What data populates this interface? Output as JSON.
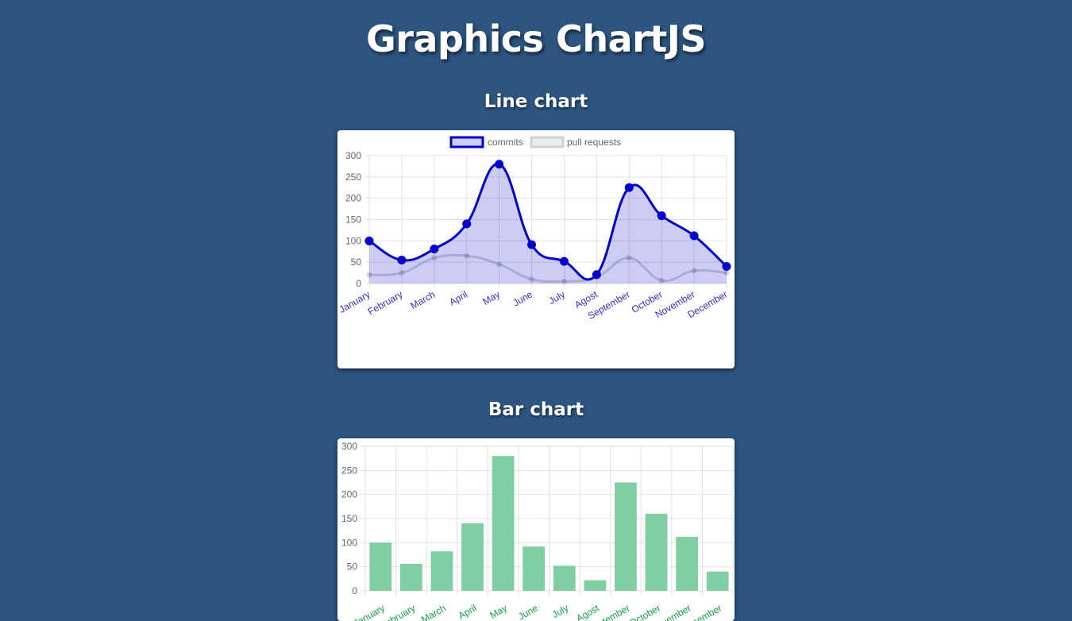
{
  "page": {
    "title": "Graphics ChartJS"
  },
  "sections": [
    {
      "title": "Line chart"
    },
    {
      "title": "Bar chart"
    }
  ],
  "chart_data": [
    {
      "type": "line",
      "categories": [
        "January",
        "February",
        "March",
        "April",
        "May",
        "June",
        "July",
        "Agost",
        "September",
        "October",
        "November",
        "December"
      ],
      "series": [
        {
          "name": "commits",
          "values": [
            100,
            55,
            81,
            140,
            280,
            91,
            52,
            21,
            225,
            159,
            112,
            40
          ],
          "color": "#0000cc",
          "fill": "rgba(0,0,204,0.2)"
        },
        {
          "name": "pull requests",
          "values": [
            20,
            25,
            60,
            65,
            45,
            10,
            5,
            15,
            60,
            7,
            30,
            25
          ],
          "color": "rgba(120,120,140,0.3)"
        }
      ],
      "ylim": [
        0,
        300
      ],
      "yticks": [
        0,
        50,
        100,
        150,
        200,
        250,
        300
      ],
      "grid": true,
      "legend": "top-center",
      "tick_color": "#3333cc"
    },
    {
      "type": "bar",
      "categories": [
        "January",
        "February",
        "March",
        "April",
        "May",
        "June",
        "July",
        "Agost",
        "September",
        "October",
        "November",
        "December"
      ],
      "values": [
        100,
        56,
        82,
        140,
        280,
        92,
        52,
        22,
        225,
        160,
        112,
        40
      ],
      "ylim": [
        0,
        300
      ],
      "yticks": [
        0,
        50,
        100,
        150,
        200,
        250,
        300
      ],
      "grid": true,
      "bar_color": "#80cfa2",
      "tick_color": "#17a34a"
    }
  ]
}
